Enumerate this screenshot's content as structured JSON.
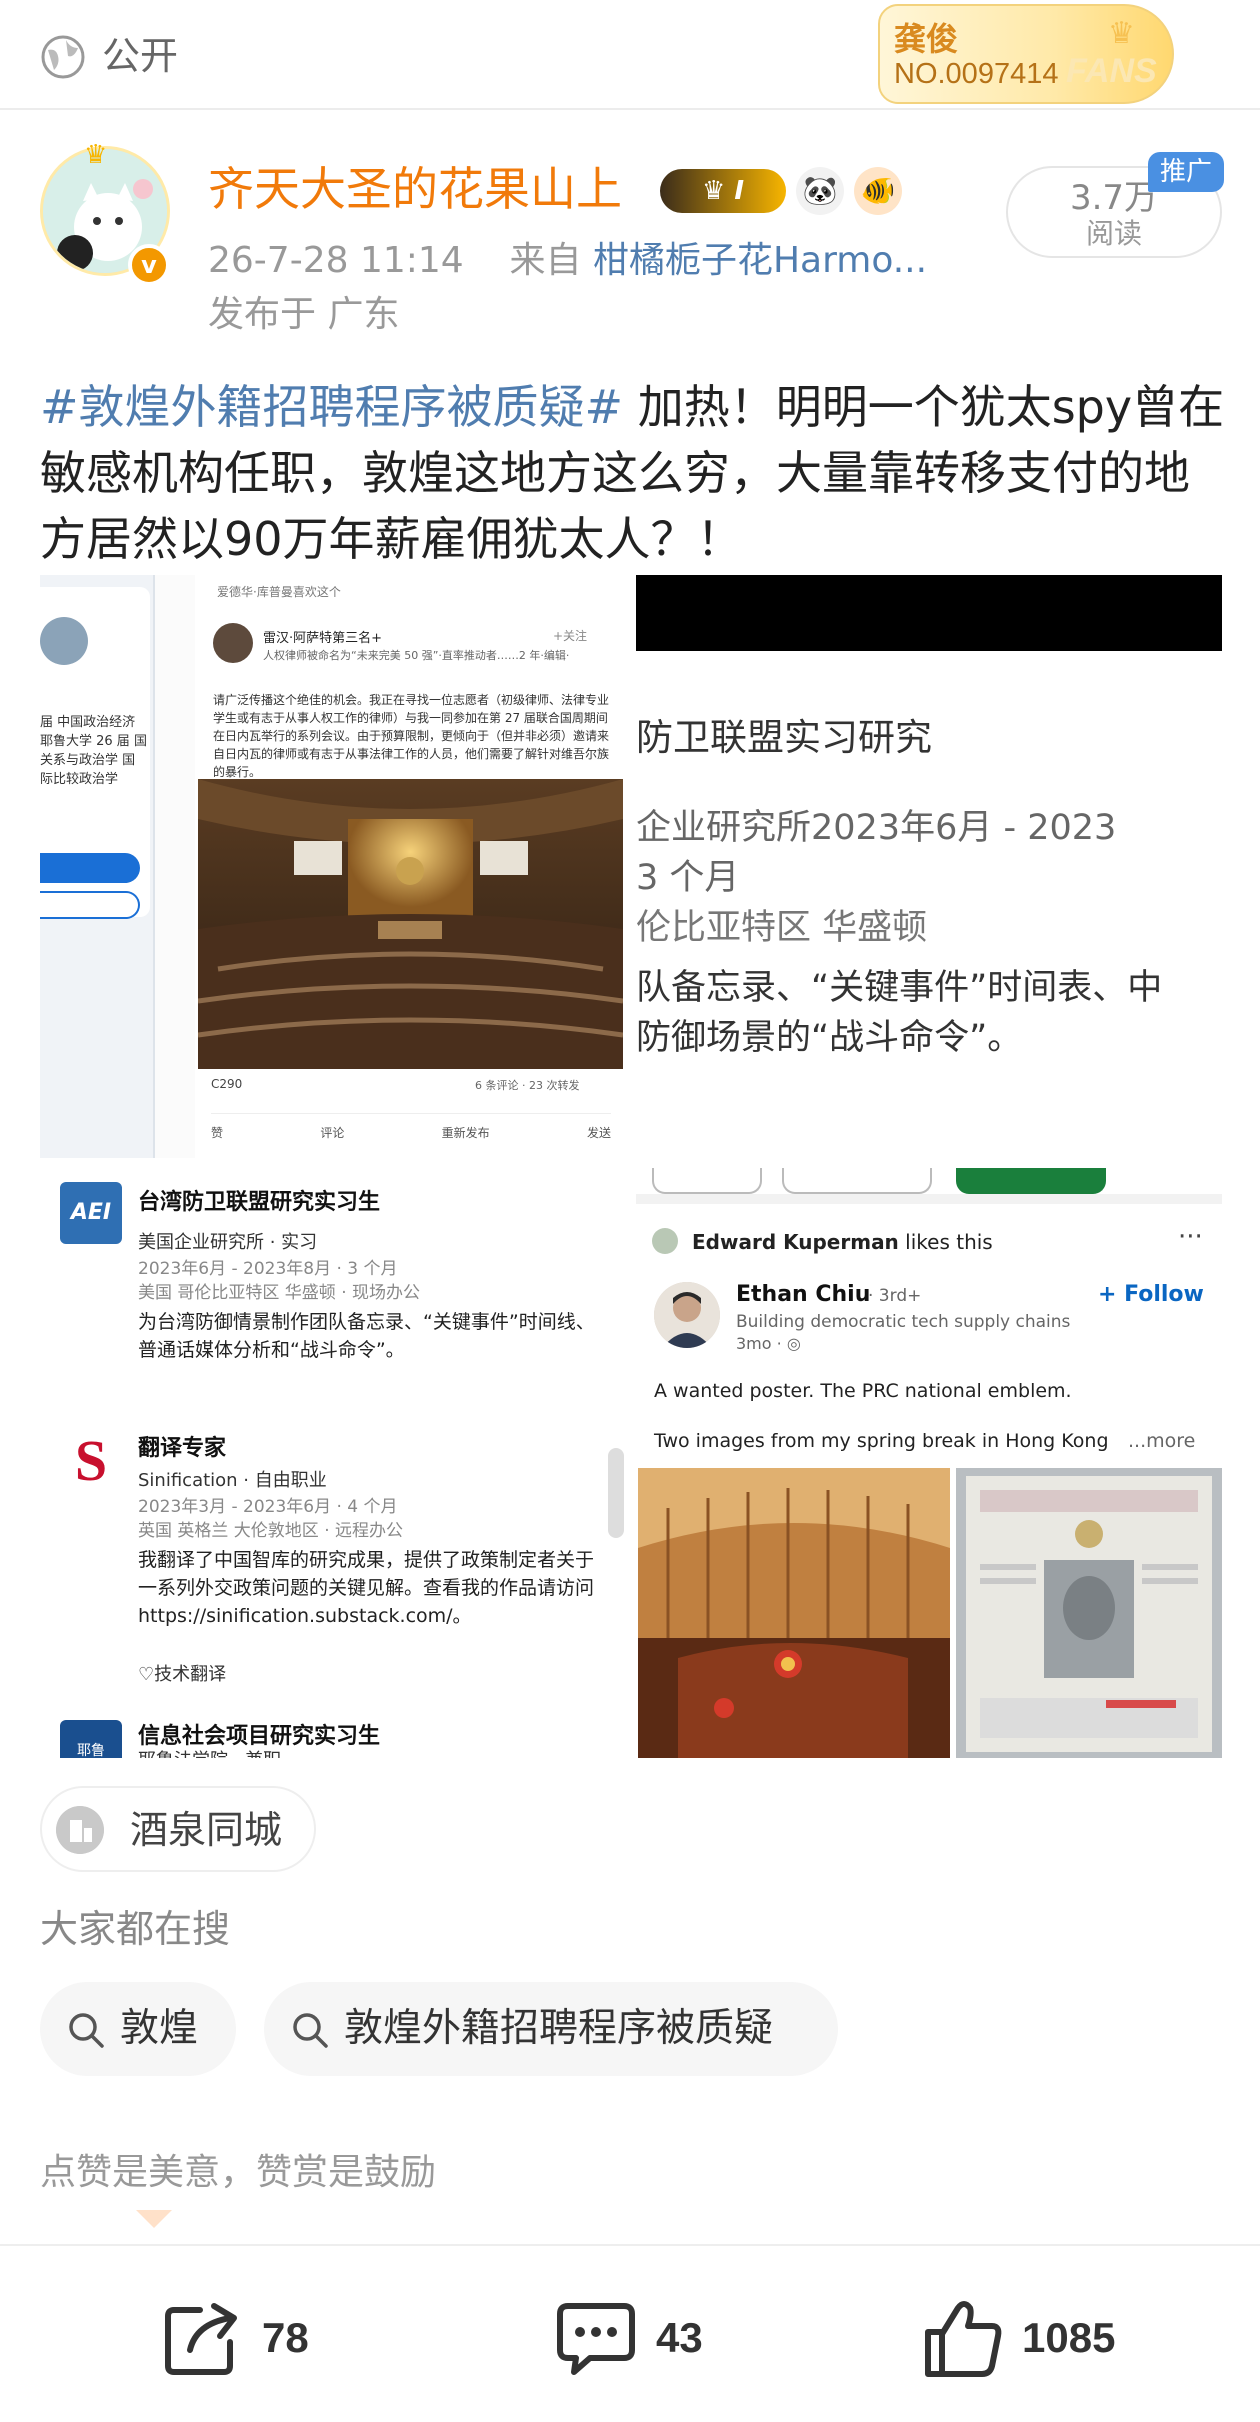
{
  "topbar": {
    "visibility_label": "公开",
    "fan_badge": {
      "title": "龚俊",
      "number": "NO.0097414",
      "word": "FANS"
    }
  },
  "author": {
    "name": "齐天大圣的花果山上",
    "vip_level": "I",
    "timestamp": "26-7-28 11:14",
    "from_label": "来自",
    "source_device": "柑橘栀子花Harmo...",
    "location": "发布于 广东"
  },
  "reads": {
    "count": "3.7万",
    "label": "阅读",
    "promo_tag": "推广"
  },
  "post": {
    "hashtag": "#敦煌外籍招聘程序被质疑#",
    "text": " 加热！明明一个犹太spy曾在敏感机构任职，敦煌这地方这么穷，大量靠转移支付的地方居然以90万年薪雇佣犹太人？！"
  },
  "images": {
    "img1": {
      "side_text": "届 中国政治经济 耶鲁大学 26 届 国关系与政治学 国际比较政治学",
      "feed_top": "爱德华·库普曼喜欢这个",
      "name": "雷汉·阿萨特第三名+",
      "follow": "+关注",
      "subtitle": "人权律师被命名为“未来完美 50 强”·直率推动者……2 年·编辑·",
      "body": "请广泛传播这个绝佳的机会。我正在寻找一位志愿者（初级律师、法律专业学生或有志于从事人权工作的律师）与我一同参加在第 27 届联合国周期间在日内瓦举行的系列会议。由于预算限制，更倾向于（但并非必须）邀请来自日内瓦的律师或有志于从事法律工作的人员，他们需要了解针对维吾尔族的暴行。",
      "reactions": "C290",
      "stats": "6 条评论 · 23 次转发",
      "actions": [
        "赞",
        "评论",
        "重新发布",
        "发送"
      ]
    },
    "img2": {
      "line1": "防卫联盟实习研究",
      "line2": "企业研究所2023年6月 - 2023",
      "line3": "3 个月",
      "line4": "伦比亚特区 华盛顿",
      "line5": "队备忘录、“关键事件”时间表、中",
      "line6": "防御场景的“战斗命令”。"
    },
    "img3": {
      "entries": [
        {
          "logo": "AEI",
          "title": "台湾防卫联盟研究实习生",
          "org": "美国企业研究所 · 实习",
          "period": "2023年6月 - 2023年8月 · 3 个月",
          "place": "美国 哥伦比亚特区 华盛顿 · 现场办公",
          "desc": "为台湾防御情景制作团队备忘录、“关键事件”时间线、普通话媒体分析和“战斗命令”。"
        },
        {
          "logo": "S",
          "title": "翻译专家",
          "org": "Sinification · 自由职业",
          "period": "2023年3月 - 2023年6月 · 4 个月",
          "place": "英国 英格兰 大伦敦地区 · 远程办公",
          "desc": "我翻译了中国智库的研究成果，提供了政策制定者关于一系列外交政策问题的关键见解。查看我的作品请访问 https://sinification.substack.com/。",
          "skill": "♡技术翻译"
        },
        {
          "logo": "耶鲁",
          "title": "信息社会项目研究实习生",
          "org": "耶鲁法学院 · 兼职"
        }
      ]
    },
    "img4": {
      "liker": "Edward Kuperman",
      "likes_suffix": "likes this",
      "more_dots": "···",
      "name": "Ethan Chiu",
      "degree": "· 3rd+",
      "follow": "+ Follow",
      "headline": "Building democratic tech supply chains",
      "time": "3mo · ◎",
      "text1": "A wanted poster. The PRC national emblem.",
      "text2": "Two images from my spring break in Hong Kong",
      "more": "...more"
    }
  },
  "location_chip": {
    "label": "酒泉同城"
  },
  "search": {
    "title": "大家都在搜",
    "items": [
      "敦煌",
      "敦煌外籍招聘程序被质疑"
    ]
  },
  "slogan": "点赞是美意，赞赏是鼓励",
  "actions": {
    "repost_count": "78",
    "comment_count": "43",
    "like_count": "1085"
  },
  "colors": {
    "username": "#f17a0a",
    "hashtag": "#507daf",
    "promo": "#4a90e2",
    "linkedin_blue": "#0a66c2"
  }
}
